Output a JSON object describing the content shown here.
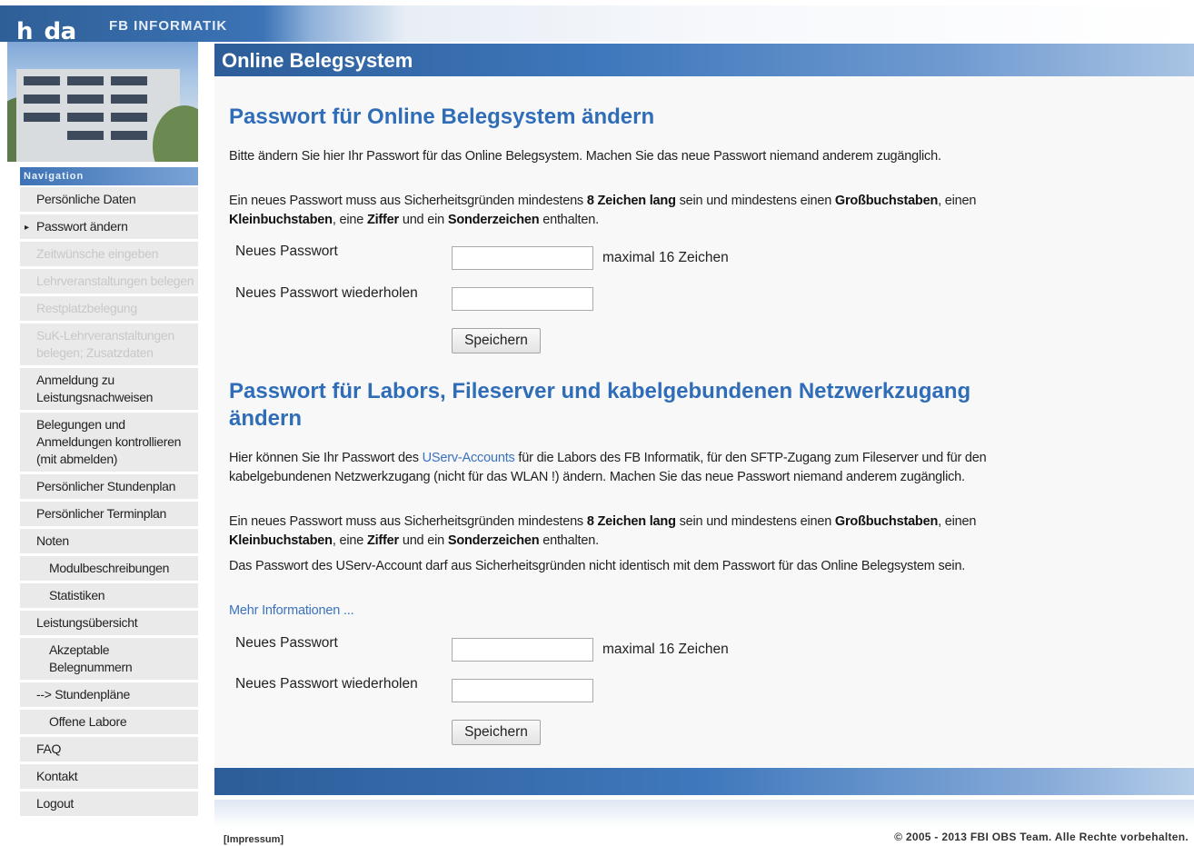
{
  "header": {
    "logo": "h_da",
    "department": "FB INFORMATIK",
    "title": "Online Belegsystem"
  },
  "sidebar": {
    "heading": "Navigation",
    "items": [
      {
        "label": "Persönliche Daten",
        "enabled": true,
        "indent": false
      },
      {
        "label": "Passwort ändern",
        "enabled": true,
        "indent": false,
        "current": true
      },
      {
        "label": "Zeitwünsche eingeben",
        "enabled": false,
        "indent": false
      },
      {
        "label": "Lehrveranstaltungen belegen",
        "enabled": false,
        "indent": false
      },
      {
        "label": "Restplatzbelegung",
        "enabled": false,
        "indent": false
      },
      {
        "label": "SuK-Lehrveranstaltungen belegen; Zusatzdaten",
        "enabled": false,
        "indent": false
      },
      {
        "label": "Anmeldung zu Leistungsnachweisen",
        "enabled": true,
        "indent": false
      },
      {
        "label": "Belegungen und Anmeldungen kontrollieren (mit abmelden)",
        "enabled": true,
        "indent": false
      },
      {
        "label": "Persönlicher Stundenplan",
        "enabled": true,
        "indent": false
      },
      {
        "label": "Persönlicher Terminplan",
        "enabled": true,
        "indent": false
      },
      {
        "label": "Noten",
        "enabled": true,
        "indent": false
      },
      {
        "label": "Modulbeschreibungen",
        "enabled": true,
        "indent": true
      },
      {
        "label": "Statistiken",
        "enabled": true,
        "indent": true
      },
      {
        "label": "Leistungsübersicht",
        "enabled": true,
        "indent": false
      },
      {
        "label": "Akzeptable Belegnummern",
        "enabled": true,
        "indent": true
      },
      {
        "label": "--> Stundenpläne",
        "enabled": true,
        "indent": false
      },
      {
        "label": "Offene Labore",
        "enabled": true,
        "indent": true
      },
      {
        "label": "FAQ",
        "enabled": true,
        "indent": false
      },
      {
        "label": "Kontakt",
        "enabled": true,
        "indent": false
      },
      {
        "label": "Logout",
        "enabled": true,
        "indent": false
      }
    ]
  },
  "section1": {
    "heading": "Passwort für Online Belegsystem ändern",
    "intro": "Bitte ändern Sie hier Ihr Passwort für das Online Belegsystem. Machen Sie das neue Passwort niemand anderem zugänglich.",
    "rules": {
      "t1": "Ein neues Passwort muss aus Sicherheitsgründen mindestens ",
      "b1": "8 Zeichen lang",
      "t2": " sein und mindestens einen ",
      "b2": "Großbuchstaben",
      "t3": ", einen ",
      "b3": "Kleinbuchstaben",
      "t4": ", eine ",
      "b4": "Ziffer",
      "t5": " und ein ",
      "b5": "Sonderzeichen",
      "t6": " enthalten."
    },
    "new_label": "Neues Passwort",
    "new_value": "",
    "hint": "maximal 16 Zeichen",
    "repeat_label": "Neues Passwort wiederholen",
    "repeat_value": "",
    "save": "Speichern"
  },
  "section2": {
    "heading_line1": "Passwort für Labors, Fileserver und kabelgebundenen Netzwerkzugang",
    "heading_line2": "ändern",
    "intro_a": "Hier können Sie Ihr Passwort des ",
    "intro_link": "UServ-Accounts",
    "intro_b": " für die Labors des FB Informatik, für den SFTP-Zugang zum Fileserver und für den kabelgebundenen Netzwerkzugang (nicht für das WLAN !) ändern. Machen Sie das neue Passwort niemand anderem zugänglich.",
    "rules": {
      "t1": "Ein neues Passwort muss aus Sicherheitsgründen mindestens ",
      "b1": "8 Zeichen lang",
      "t2": " sein und mindestens einen ",
      "b2": "Großbuchstaben",
      "t3": ", einen ",
      "b3": "Kleinbuchstaben",
      "t4": ", eine ",
      "b4": "Ziffer",
      "t5": " und ein ",
      "b5": "Sonderzeichen",
      "t6": " enthalten."
    },
    "note": "Das Passwort des UServ-Account darf aus Sicherheitsgründen nicht identisch mit dem Passwort für das Online Belegsystem sein.",
    "more_info": "Mehr Informationen ...",
    "new_label": "Neues Passwort",
    "new_value": "",
    "hint": "maximal 16 Zeichen",
    "repeat_label": "Neues Passwort wiederholen",
    "repeat_value": "",
    "save": "Speichern"
  },
  "footer": {
    "impressum": "[Impressum]",
    "copyright": "© 2005 - 2013 FBI OBS Team. Alle Rechte vorbehalten."
  },
  "colors": {
    "accent": "#2f6db8",
    "header_blue": "#2c5d99",
    "link": "#3a72c2",
    "nav_bg": "#eaeaea",
    "disabled_text": "#c8c8c8"
  }
}
